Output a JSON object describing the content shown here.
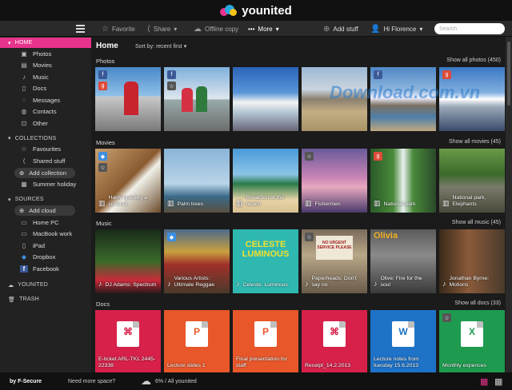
{
  "app": {
    "name": "younited"
  },
  "toolbar": {
    "favorite": "Favorite",
    "share": "Share",
    "offline": "Offline copy",
    "more": "More",
    "add_stuff": "Add stuff",
    "user": "Hi Florence",
    "search_placeholder": "Search"
  },
  "sidebar": {
    "home": "HOME",
    "home_items": [
      {
        "label": "Photos",
        "icon": "photos-icon"
      },
      {
        "label": "Movies",
        "icon": "movies-icon"
      },
      {
        "label": "Music",
        "icon": "music-icon"
      },
      {
        "label": "Docs",
        "icon": "docs-icon"
      },
      {
        "label": "Messages",
        "icon": "messages-icon"
      },
      {
        "label": "Contacts",
        "icon": "contacts-icon"
      },
      {
        "label": "Other",
        "icon": "other-icon"
      }
    ],
    "collections": "COLLECTIONS",
    "collection_items": [
      "Favourites",
      "Shared stuff",
      "Add collection",
      "Summer holiday"
    ],
    "sources": "SOURCES",
    "source_items": [
      "Add cloud",
      "Home PC",
      "MacBook work",
      "iPad",
      "Dropbox",
      "Facebook"
    ],
    "younited": "YOUNITED",
    "trash": "TRASH"
  },
  "main": {
    "title": "Home",
    "sort": "Sort by: recent first"
  },
  "rows": {
    "photos": {
      "title": "Photos",
      "link": "Show all photos (450)"
    },
    "movies": {
      "title": "Movies",
      "link": "Show all movies (45)",
      "items": [
        "Harry opening a coconut",
        "Palm trees",
        "Breakfast at the beach",
        "Fishermen",
        "National park",
        "National park, Elephants"
      ]
    },
    "music": {
      "title": "Music",
      "link": "Show all music (45)",
      "items": [
        "DJ Adams: Spectrum",
        "Various Artists: Ultimate Reggae",
        "Celeste: Luminous",
        "Paperheads: Don't say no",
        "Olive: Fire for the soul",
        "Jonathan Byrne: Motions"
      ]
    },
    "docs": {
      "title": "Docs",
      "link": "Show all docs (33)",
      "items": [
        "E-ticket ARL-TKL 2445-22338",
        "Lecture slides 1",
        "Final presentation for staff",
        "Receipt_14.2.2013",
        "Lecture notes from tuesday 15.6.2013",
        "Monthly expences"
      ]
    }
  },
  "art": {
    "celeste": "CELESTE LUMINOUS",
    "olivia": "Olivia",
    "no_urgent": "NO URGENT SERVICE PLEASE"
  },
  "watermark": "Download.com.vn",
  "bottom": {
    "brand": "by F-Secure",
    "need": "Need more space?",
    "usage": "6% / All younited"
  },
  "colors": {
    "accent": "#e8338c",
    "doc_pink": "#d8214a",
    "doc_orange": "#e8572a",
    "doc_blue": "#1e73c8",
    "doc_green": "#1e9b4f"
  }
}
